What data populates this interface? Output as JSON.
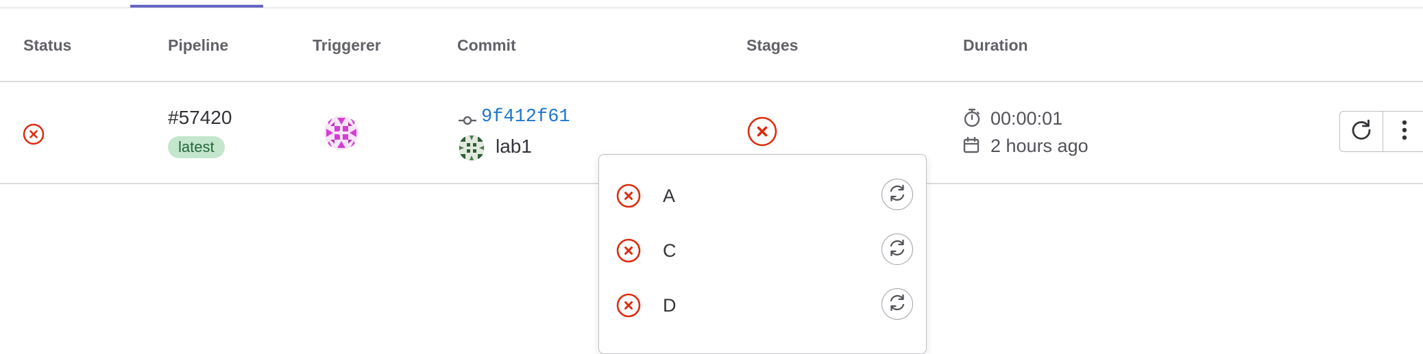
{
  "table": {
    "headers": {
      "status": "Status",
      "pipeline": "Pipeline",
      "triggerer": "Triggerer",
      "commit": "Commit",
      "stages": "Stages",
      "duration": "Duration"
    }
  },
  "row": {
    "status": "failed",
    "pipeline_id": "#57420",
    "badge": "latest",
    "triggerer_avatar": "identicon-avatar",
    "commit_sha": "9f412f61",
    "author": "lab1",
    "stage_status": "failed",
    "duration": "00:00:01",
    "finished": "2 hours ago",
    "actions": [
      "retry-icon",
      "kebab-menu-icon"
    ]
  },
  "stage_dropdown": {
    "jobs": [
      {
        "name": "A",
        "status": "failed",
        "action": "retry-icon"
      },
      {
        "name": "C",
        "status": "failed",
        "action": "retry-icon"
      },
      {
        "name": "D",
        "status": "failed",
        "action": "retry-icon"
      }
    ]
  },
  "colors": {
    "failed": "#dd2b0e",
    "link": "#1f75cb",
    "badge_bg": "#c3e6cd",
    "badge_text": "#24663b",
    "active_tab": "#6666c4"
  }
}
